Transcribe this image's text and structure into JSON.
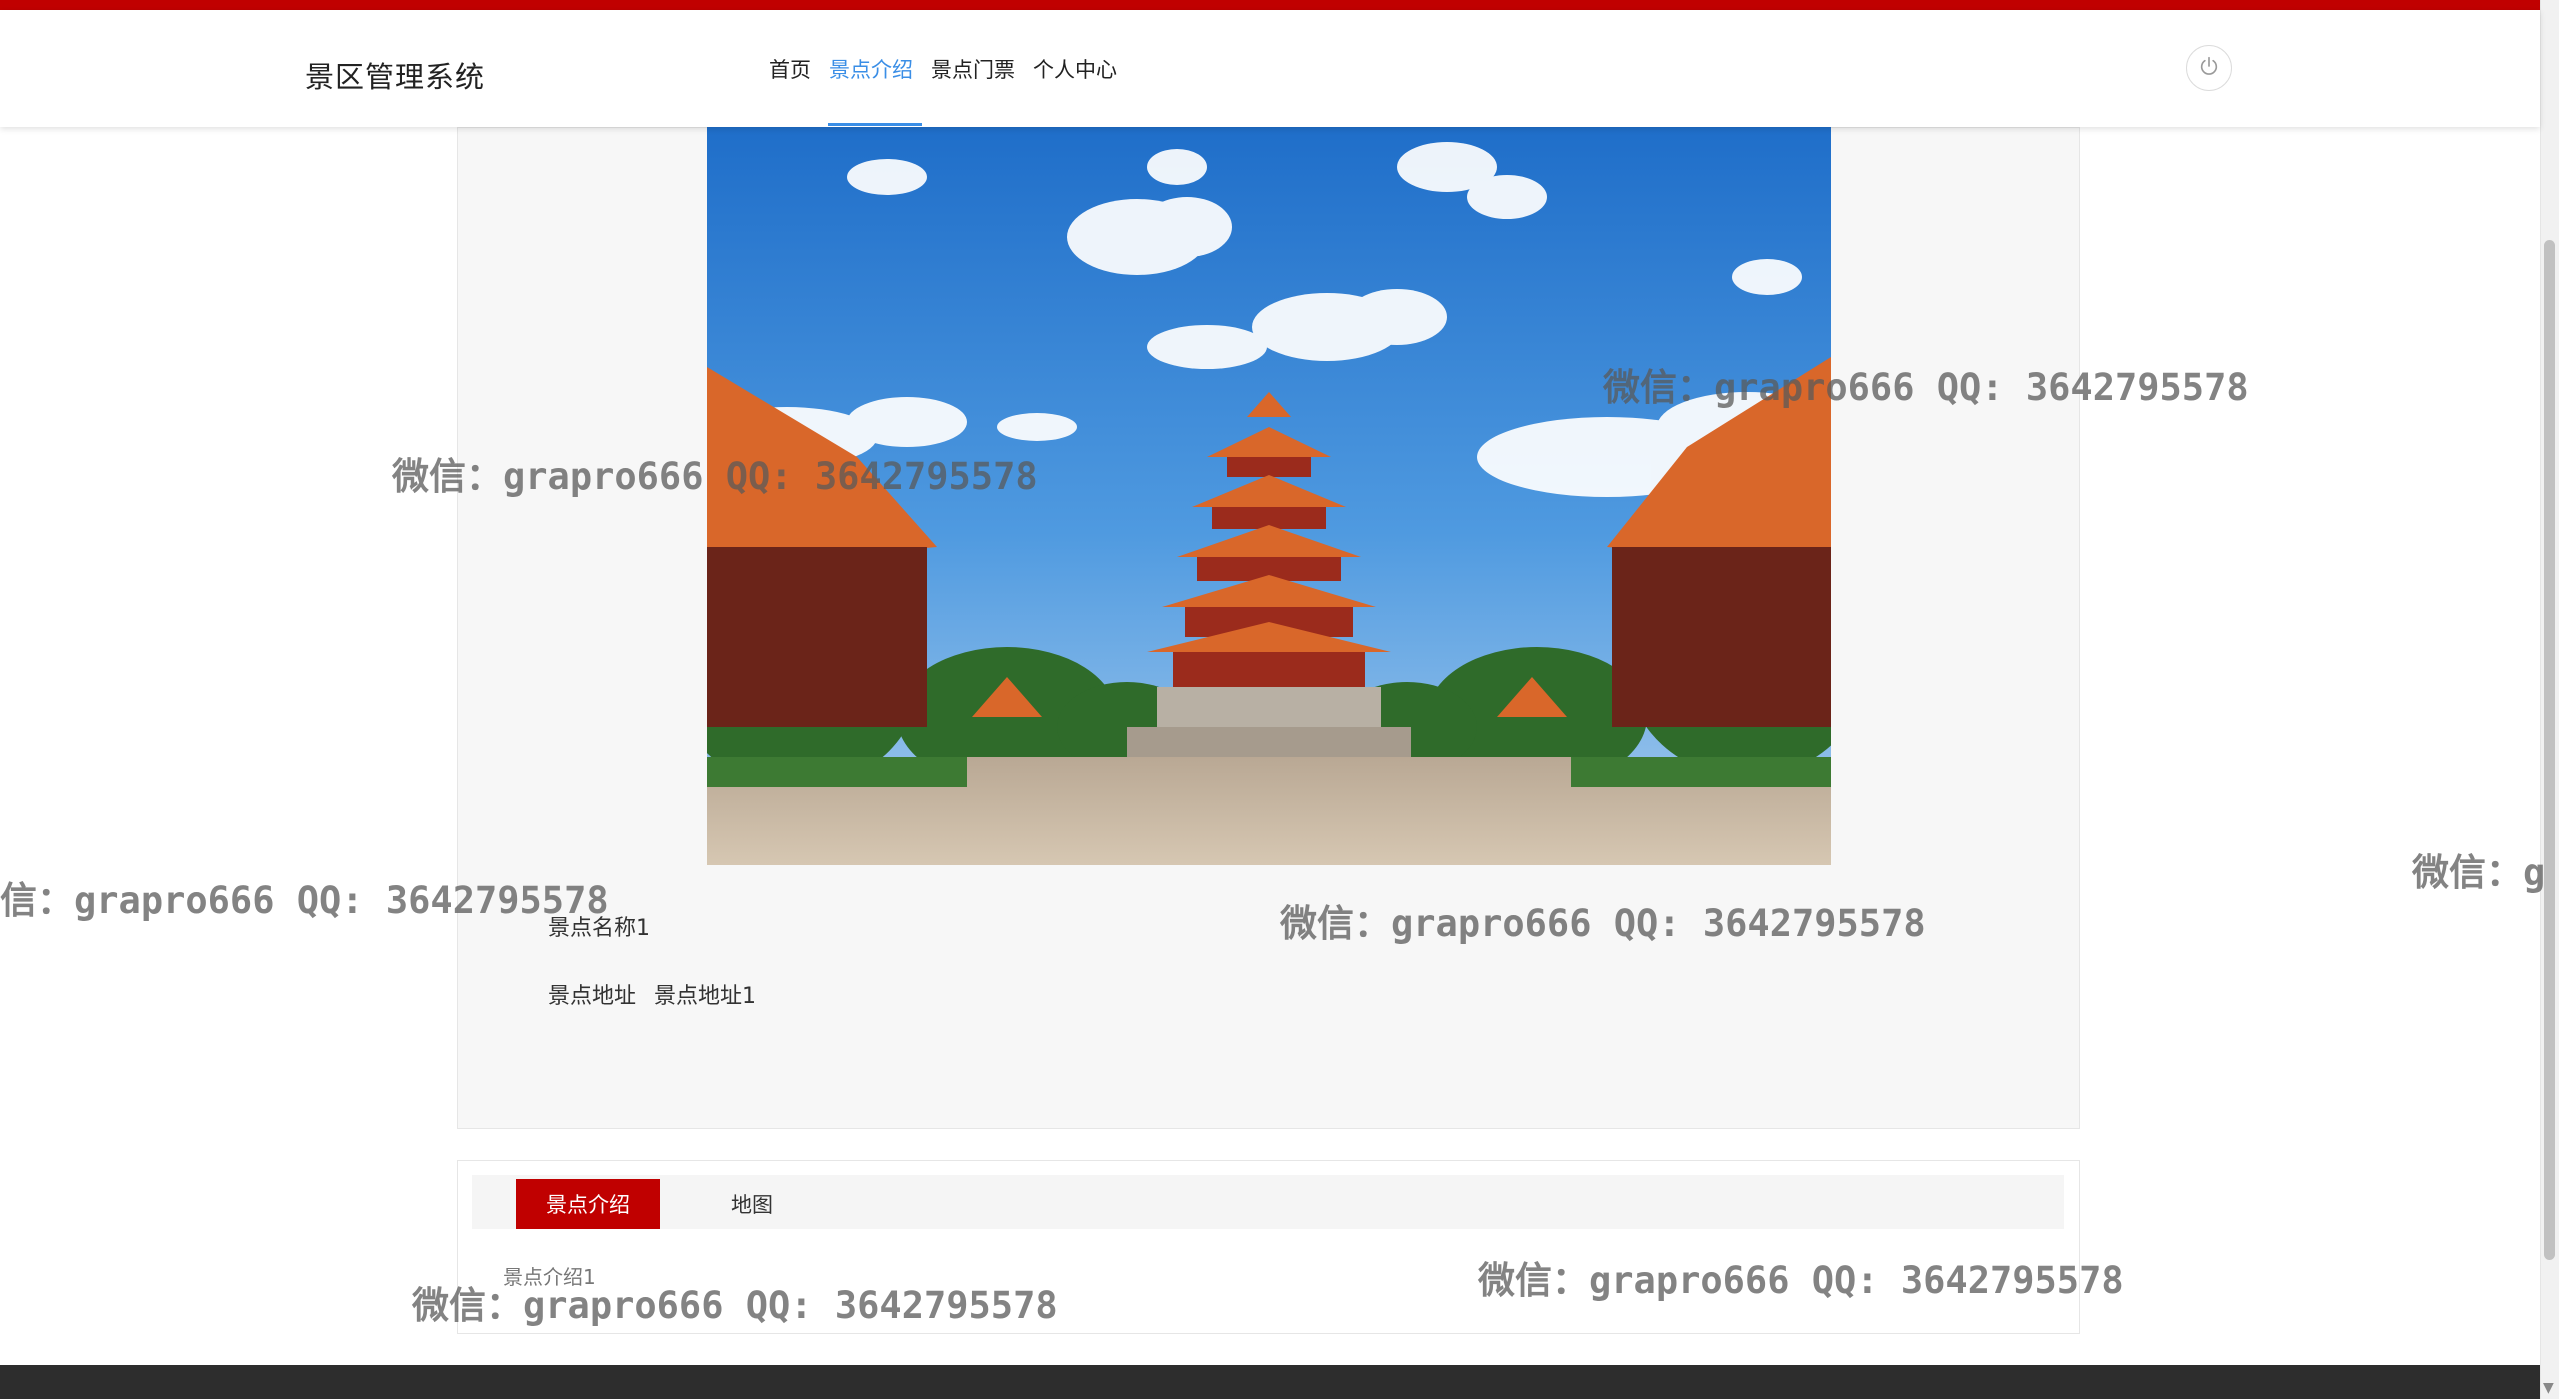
{
  "header": {
    "brand": "景区管理系统",
    "nav": [
      "首页",
      "景点介绍",
      "景点门票",
      "个人中心"
    ],
    "active_nav": "景点介绍",
    "power_icon": "power-icon"
  },
  "detail": {
    "name": "景点名称1",
    "address_label": "景点地址",
    "address_value": "景点地址1"
  },
  "tabs": {
    "items": [
      "景点介绍",
      "地图"
    ],
    "active": "景点介绍",
    "content": "景点介绍1"
  },
  "watermark": {
    "main": "微信：grapro666 QQ: 3642795578",
    "partial_left": "信：grapro666 QQ: 3642795578",
    "partial_right": "微信：g"
  },
  "colors": {
    "accent": "#c00000",
    "nav_active": "#3a8ee6",
    "footer": "#2d2d2d"
  }
}
